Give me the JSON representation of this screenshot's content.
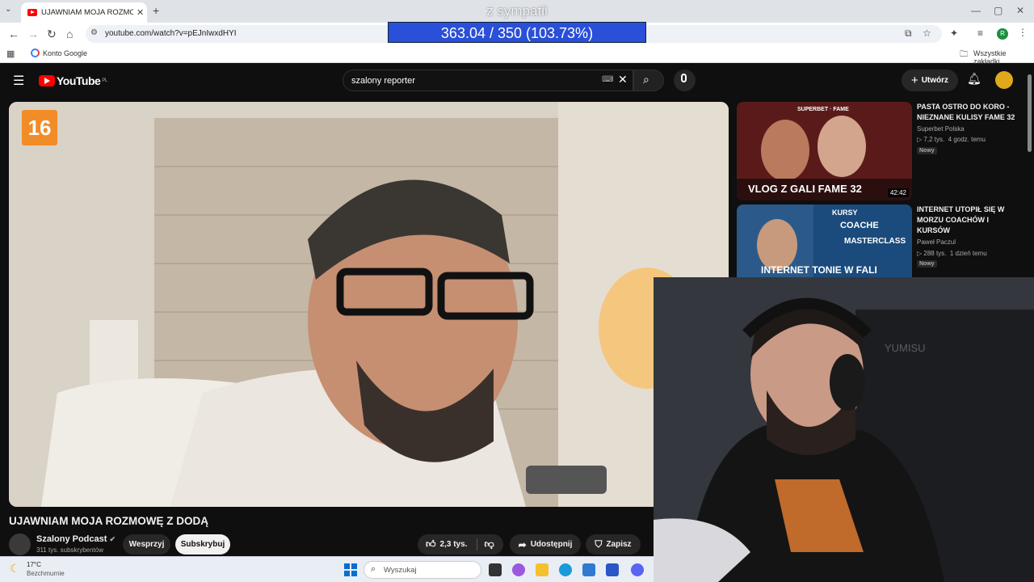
{
  "browser": {
    "tab_title": "UJAWNIAM MOJA ROZMOWĘ Z",
    "url": "youtube.com/watch?v=pEJnIwxdHYI",
    "bookmark_google": "Konto Google",
    "bookmark_all": "Wszystkie zakładki",
    "profile_initial": "R"
  },
  "overlay": {
    "title": "z sympatii",
    "counter": "363.04 / 350 (103.73%)"
  },
  "youtube": {
    "logo_text": "YouTube",
    "logo_region": "PL",
    "search_value": "szalony reporter",
    "create_label": "Utwórz"
  },
  "video": {
    "age_rating": "16",
    "title": "UJAWNIAM MOJA ROZMOWĘ Z DODĄ",
    "channel": "Szalony Podcast",
    "subscribers": "311 tys. subskrybentów",
    "support_label": "Wesprzyj",
    "subscribe_label": "Subskrybuj",
    "likes": "2,3 tys.",
    "share_label": "Udostępnij",
    "save_label": "Zapisz"
  },
  "recommendations": [
    {
      "title": "PASTA OSTRO DO KORO - NIEZNANE KULISY FAME 32",
      "channel": "Superbet Polska",
      "views": "7,2 tys.",
      "age": "4 godz. temu",
      "badge": "Nowy",
      "duration": "42:42",
      "thumb_text": "VLOG Z GALI FAME 32",
      "thumb_top_text": "SUPERBET · FAME"
    },
    {
      "title": "INTERNET UTOPIŁ SIĘ W MORZU COACHÓW I KURSÓW",
      "channel": "Paweł Paczul",
      "views": "288 tys.",
      "age": "1 dzień temu",
      "badge": "Nowy",
      "thumb_text": "INTERNET TONIE W FALI",
      "thumb_words": [
        "KURSY",
        "COACHE",
        "MASTERCLASS"
      ]
    }
  ],
  "taskbar": {
    "temp": "17°C",
    "weather": "Bezchmurnie",
    "search_placeholder": "Wyszukaj"
  },
  "webcam": {
    "chair_text": "YUMISU"
  }
}
